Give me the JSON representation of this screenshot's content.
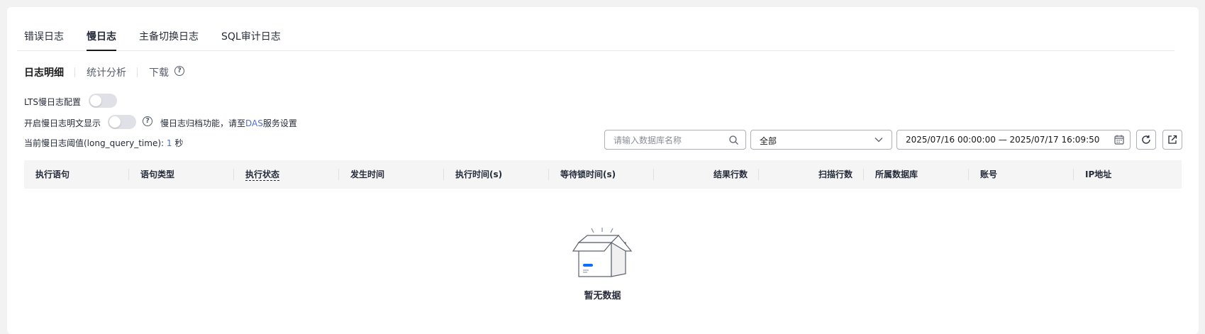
{
  "tabs": {
    "items": [
      {
        "label": "错误日志"
      },
      {
        "label": "慢日志"
      },
      {
        "label": "主备切换日志"
      },
      {
        "label": "SQL审计日志"
      }
    ],
    "active": "慢日志"
  },
  "subtabs": {
    "items": [
      {
        "label": "日志明细"
      },
      {
        "label": "统计分析"
      },
      {
        "label": "下载"
      }
    ],
    "active": "日志明细"
  },
  "settings": {
    "lts_label": "LTS慢日志配置",
    "plaintext_label": "开启慢日志明文显示",
    "archive_prefix": "慢日志归档功能，请至",
    "archive_link": "DAS",
    "archive_suffix": "服务设置",
    "threshold_label": "当前慢日志阈值(long_query_time):",
    "threshold_value": "1",
    "threshold_unit": "秒"
  },
  "filters": {
    "search_placeholder": "请输入数据库名称",
    "type_selected": "全部",
    "date_range": "2025/07/16 00:00:00 — 2025/07/17 16:09:50"
  },
  "table": {
    "columns": [
      "执行语句",
      "语句类型",
      "执行状态",
      "发生时间",
      "执行时间(s)",
      "等待锁时间(s)",
      "结果行数",
      "扫描行数",
      "所属数据库",
      "账号",
      "IP地址"
    ]
  },
  "empty": {
    "text": "暂无数据"
  },
  "colors": {
    "accent": "#526ecc",
    "active_tab_underline": "#191919",
    "empty_icon_blue": "#0d6efd"
  }
}
